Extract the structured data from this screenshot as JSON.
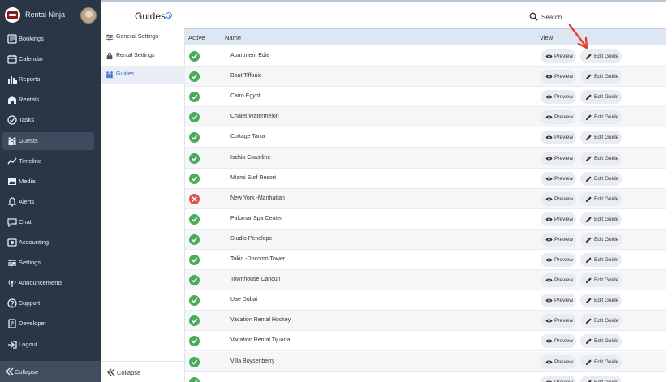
{
  "sidebar": {
    "brand_name": "Rental Ninja",
    "items": [
      {
        "label": "Bookings",
        "icon": "bookings-icon"
      },
      {
        "label": "Calendar",
        "icon": "calendar-icon"
      },
      {
        "label": "Reports",
        "icon": "reports-icon"
      },
      {
        "label": "Rentals",
        "icon": "rentals-icon"
      },
      {
        "label": "Tasks",
        "icon": "tasks-icon"
      },
      {
        "label": "Guests",
        "icon": "guests-icon",
        "active": true
      },
      {
        "label": "Timeline",
        "icon": "timeline-icon"
      },
      {
        "label": "Media",
        "icon": "media-icon"
      },
      {
        "label": "Alerts",
        "icon": "alerts-icon"
      },
      {
        "label": "Chat",
        "icon": "chat-icon"
      },
      {
        "label": "Accounting",
        "icon": "accounting-icon"
      },
      {
        "label": "Settings",
        "icon": "settings-icon"
      },
      {
        "label": "Announcements",
        "icon": "announcements-icon"
      },
      {
        "label": "Support",
        "icon": "support-icon"
      },
      {
        "label": "Developer",
        "icon": "developer-icon"
      },
      {
        "label": "Logout",
        "icon": "logout-icon"
      }
    ],
    "collapse_label": "Collapse"
  },
  "header": {
    "title": "Guides",
    "search_placeholder": "Search"
  },
  "settings_panel": {
    "items": [
      {
        "label": "General Settings",
        "icon": "sliders-icon"
      },
      {
        "label": "Rental Settings",
        "icon": "lock-icon"
      },
      {
        "label": "Guides",
        "icon": "guides-icon",
        "active": true
      }
    ],
    "collapse_label": "Collapse"
  },
  "table": {
    "headers": {
      "active": "Active",
      "name": "Name",
      "view": "View"
    },
    "preview_label": "Preview",
    "edit_label": "Edit Guide",
    "rows": [
      {
        "name": "Apartment Edie",
        "active": true
      },
      {
        "name": "Boat Tiffanie",
        "active": true
      },
      {
        "name": "Cairo Egypt",
        "active": true
      },
      {
        "name": "Chalet Watermelon",
        "active": true
      },
      {
        "name": "Cottage Tarra",
        "active": true
      },
      {
        "name": "Ischia Coastline",
        "active": true
      },
      {
        "name": "Miami Surf Resort",
        "active": true
      },
      {
        "name": "New York -Manhattan",
        "active": false
      },
      {
        "name": "Palomar Spa Center",
        "active": true
      },
      {
        "name": "Studio Penelope",
        "active": true
      },
      {
        "name": "Tokio -Docomo Tower",
        "active": true
      },
      {
        "name": "Townhouse Cancun",
        "active": true
      },
      {
        "name": "Uae Dubai",
        "active": true
      },
      {
        "name": "Vacation Rental Hockey",
        "active": true
      },
      {
        "name": "Vacation Rental Tijuana",
        "active": true
      },
      {
        "name": "Villa Boysenberry",
        "active": true
      },
      {
        "name": "",
        "active": true
      }
    ]
  },
  "colors": {
    "sidebar_bg": "#2a3646",
    "active_ok": "#4cab5a",
    "inactive": "#d9534f",
    "accent": "#2f6fc2",
    "annotation_arrow": "#e8412c"
  }
}
